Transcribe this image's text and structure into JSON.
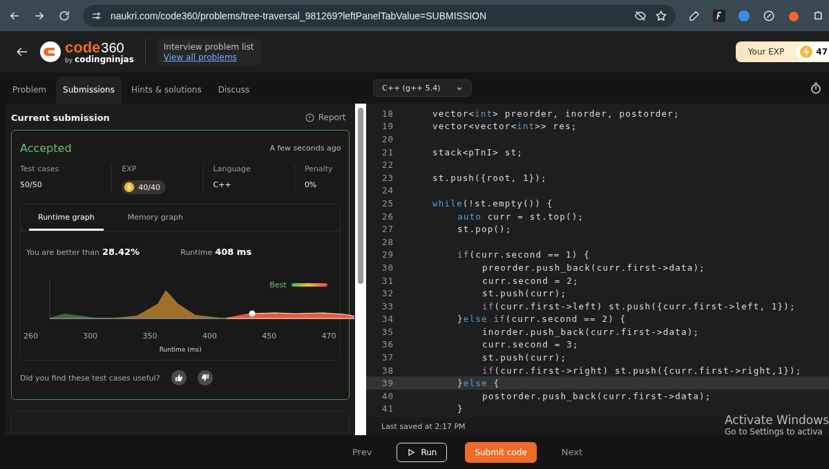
{
  "browser": {
    "url": "naukri.com/code360/problems/tree-traversal_981269?leftPanelTabValue=SUBMISSION"
  },
  "header": {
    "logo_word": "code",
    "logo_number": "360",
    "logo_by": "by",
    "logo_brand": "codingninjas",
    "list_title": "Interview problem list",
    "list_link": "View all problems",
    "exp_label": "Your EXP",
    "exp_value": "47"
  },
  "tabs": [
    {
      "label": "Problem",
      "selected": false
    },
    {
      "label": "Submissions",
      "selected": true
    },
    {
      "label": "Hints & solutions",
      "selected": false
    },
    {
      "label": "Discuss",
      "selected": false
    }
  ],
  "language": "C++ (g++ 5.4)",
  "submission": {
    "title": "Current submission",
    "report": "Report",
    "status": "Accepted",
    "time": "A few seconds ago",
    "stats": [
      {
        "label": "Test cases",
        "value": "50/50",
        "kind": "text"
      },
      {
        "label": "EXP",
        "value": "40/40",
        "kind": "exp"
      },
      {
        "label": "Language",
        "value": "C++",
        "kind": "text"
      },
      {
        "label": "Penalty",
        "value": "0%",
        "kind": "text"
      }
    ],
    "graph_tabs": [
      {
        "label": "Runtime graph",
        "selected": true
      },
      {
        "label": "Memory graph",
        "selected": false
      }
    ],
    "better_label": "You are better than",
    "better_value": "28.42%",
    "runtime_label": "Runtime",
    "runtime_value": "408 ms",
    "legend": "Best",
    "x_ticks": [
      "260",
      "300",
      "350",
      "400",
      "450",
      "470"
    ],
    "x_label": "Runtime (ms)",
    "feedback": "Did you find these test cases useful?"
  },
  "editor": {
    "lines": [
      {
        "number": "18",
        "current": false,
        "segments": [
          {
            "text": "vector<",
            "kind": "plain"
          },
          {
            "text": "int",
            "kind": "keyword"
          },
          {
            "text": "> preorder, inorder, postorder;",
            "kind": "plain"
          }
        ]
      },
      {
        "number": "19",
        "current": false,
        "segments": [
          {
            "text": "vector<vector<",
            "kind": "plain"
          },
          {
            "text": "int",
            "kind": "keyword"
          },
          {
            "text": ">> res;",
            "kind": "plain"
          }
        ]
      },
      {
        "number": "20",
        "current": false
      },
      {
        "number": "21",
        "current": false,
        "segments": [
          {
            "text": "stack<pTnI> st;",
            "kind": "plain"
          }
        ]
      },
      {
        "number": "22",
        "current": false
      },
      {
        "number": "23",
        "current": false,
        "segments": [
          {
            "text": "st.push({root, 1});",
            "kind": "plain"
          }
        ]
      },
      {
        "number": "24",
        "current": false
      },
      {
        "number": "25",
        "current": false,
        "segments": [
          {
            "text": "while",
            "kind": "keyword"
          },
          {
            "text": "(!st.empty()) {",
            "kind": "plain"
          }
        ],
        "children": [
          {
            "number": "26",
            "current": false,
            "segments": [
              {
                "text": "auto",
                "kind": "keyword"
              },
              {
                "text": " curr = st.top();",
                "kind": "plain"
              }
            ]
          },
          {
            "number": "27",
            "current": false,
            "segments": [
              {
                "text": "st.pop();",
                "kind": "plain"
              }
            ]
          },
          {
            "number": "28",
            "current": false
          },
          {
            "number": "29",
            "current": false,
            "segments": [
              {
                "text": "if",
                "kind": "control"
              },
              {
                "text": "(curr.second == 1) {",
                "kind": "plain"
              }
            ],
            "children": [
              {
                "number": "30",
                "current": false,
                "segments": [
                  {
                    "text": "preorder.push_back(curr.first->data);",
                    "kind": "plain"
                  }
                ]
              },
              {
                "number": "31",
                "current": false,
                "segments": [
                  {
                    "text": "curr.second = 2;",
                    "kind": "plain"
                  }
                ]
              },
              {
                "number": "32",
                "current": false,
                "segments": [
                  {
                    "text": "st.push(curr);",
                    "kind": "plain"
                  }
                ]
              },
              {
                "number": "33",
                "current": false,
                "segments": [
                  {
                    "text": "if",
                    "kind": "control"
                  },
                  {
                    "text": "(curr.first->left) st.push({curr.first->left, 1});",
                    "kind": "plain"
                  }
                ]
              }
            ]
          },
          {
            "number": "34",
            "current": false,
            "segments": [
              {
                "text": "}",
                "kind": "plain"
              },
              {
                "text": "else",
                "kind": "keyword"
              },
              {
                "text": "if",
                "kind": "control"
              },
              {
                "text": "(curr.second == 2) {",
                "kind": "plain"
              }
            ],
            "children": [
              {
                "number": "35",
                "current": false,
                "segments": [
                  {
                    "text": "inorder.push_back(curr.first->data);",
                    "kind": "plain"
                  }
                ]
              },
              {
                "number": "36",
                "current": false,
                "segments": [
                  {
                    "text": "curr.second = 3;",
                    "kind": "plain"
                  }
                ]
              },
              {
                "number": "37",
                "current": false,
                "segments": [
                  {
                    "text": "st.push(curr);",
                    "kind": "plain"
                  }
                ]
              },
              {
                "number": "38",
                "current": false,
                "segments": [
                  {
                    "text": "if",
                    "kind": "control"
                  },
                  {
                    "text": "(curr.first->right) st.push({curr.first->right,1});",
                    "kind": "plain"
                  }
                ]
              }
            ]
          },
          {
            "number": "39",
            "current": true,
            "segments": [
              {
                "text": "}",
                "kind": "plain"
              },
              {
                "text": "else",
                "kind": "keyword"
              },
              {
                "text": "{",
                "kind": "plain"
              }
            ],
            "children": [
              {
                "number": "40",
                "current": false,
                "segments": [
                  {
                    "text": "postorder.push_back(curr.first->data);",
                    "kind": "plain"
                  }
                ]
              }
            ]
          },
          {
            "number": "41",
            "current": false,
            "segments": [
              {
                "text": "}",
                "kind": "plain"
              }
            ]
          }
        ]
      }
    ],
    "last_saved": "Last saved at 2:17 PM"
  },
  "footer": {
    "prev": "Prev",
    "run": "Run",
    "submit": "Submit code",
    "next": "Next"
  },
  "os_notice": {
    "title": "Activate Windows",
    "subtitle": "Go to Settings to activa"
  }
}
